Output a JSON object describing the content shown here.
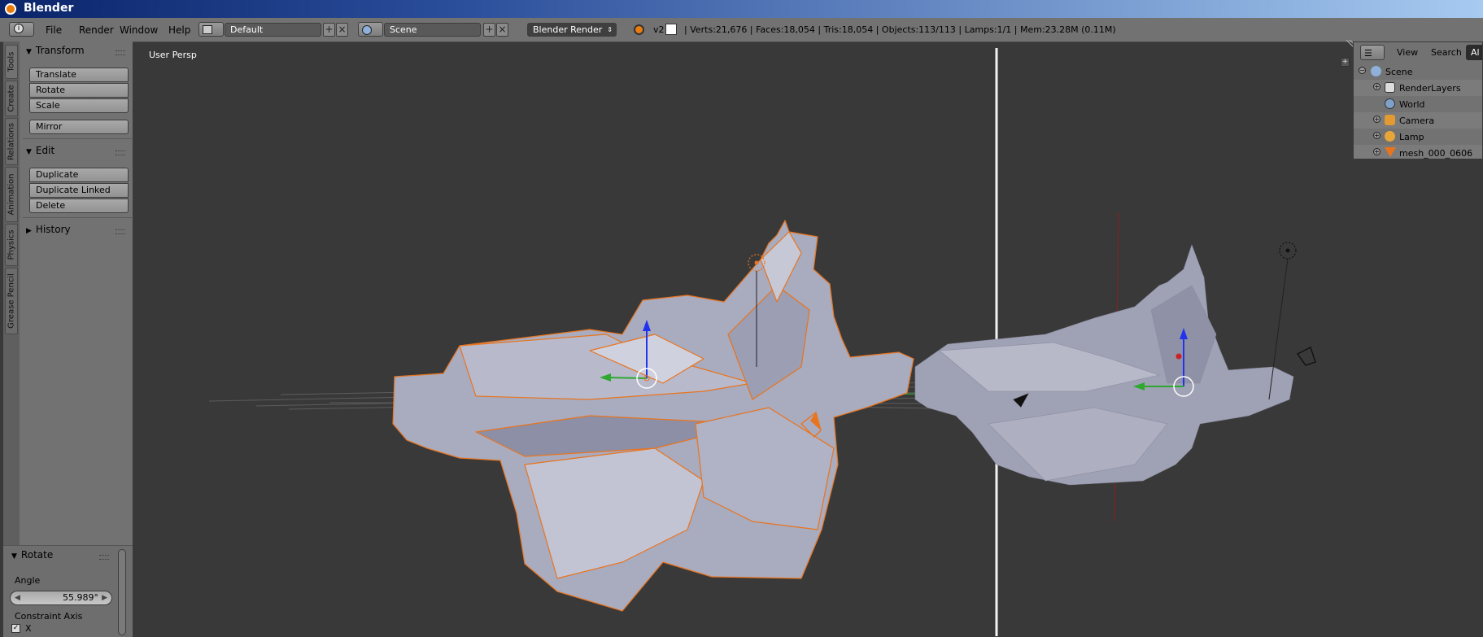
{
  "window": {
    "title": "Blender"
  },
  "infobar": {
    "menus": [
      "File",
      "Render",
      "Window",
      "Help"
    ],
    "screen_layout": "Default",
    "scene": "Scene",
    "render_engine": "Blender Render",
    "version": "v2",
    "stats": "| Verts:21,676 | Faces:18,054 | Tris:18,054 | Objects:113/113 | Lamps:1/1 | Mem:23.28M (0.11M)"
  },
  "toolshelf": {
    "tabs": [
      "Tools",
      "Create",
      "Relations",
      "Animation",
      "Physics",
      "Grease Pencil"
    ],
    "transform": {
      "header": "Transform",
      "buttons": [
        "Translate",
        "Rotate",
        "Scale",
        "Mirror"
      ]
    },
    "edit": {
      "header": "Edit",
      "buttons": [
        "Duplicate",
        "Duplicate Linked",
        "Delete"
      ]
    },
    "history": {
      "header": "History"
    }
  },
  "redo_panel": {
    "header": "Rotate",
    "angle_label": "Angle",
    "angle_value": "55.989°",
    "constraint_label": "Constraint Axis",
    "constraint_x": "X"
  },
  "viewport": {
    "label": "User Persp"
  },
  "outliner": {
    "header": {
      "view": "View",
      "search": "Search",
      "filter": "Al"
    },
    "items": [
      {
        "label": "Scene",
        "icon": "scene-icon"
      },
      {
        "label": "RenderLayers",
        "icon": "renderlayers-icon"
      },
      {
        "label": "World",
        "icon": "world-icon"
      },
      {
        "label": "Camera",
        "icon": "camera-icon"
      },
      {
        "label": "Lamp",
        "icon": "lamp-icon"
      },
      {
        "label": "mesh_000_0606",
        "icon": "mesh-icon"
      }
    ]
  },
  "colors": {
    "viewport_bg": "#393939",
    "panel_bg": "#727272",
    "selection_outline": "#e8741e",
    "axis_x": "#cc2222",
    "axis_y": "#22aa22",
    "axis_z": "#2233ee"
  }
}
